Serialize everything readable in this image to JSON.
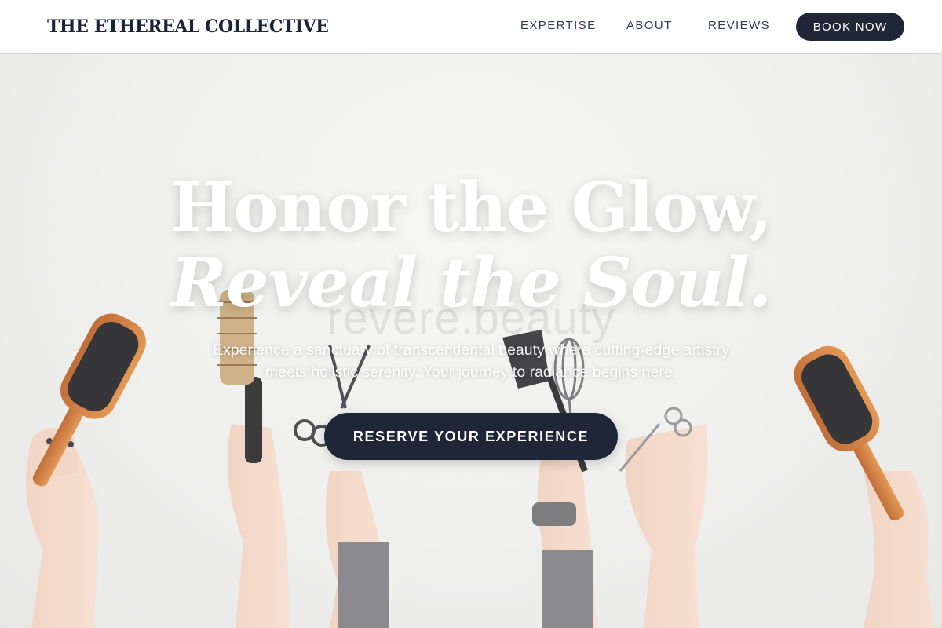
{
  "brand": {
    "name": "THE ETHEREAL COLLECTIVE"
  },
  "nav": {
    "items": [
      {
        "label": "EXPERTISE"
      },
      {
        "label": "ABOUT"
      },
      {
        "label": "REVIEWS"
      }
    ],
    "cta_label": "BOOK NOW"
  },
  "hero": {
    "headline_line1": "Honor the Glow,",
    "headline_line2": "Reveal the Soul.",
    "watermark": "revere.beauty",
    "subtitle": "Experience a sanctuary of transcendental beauty where cutting-edge artistry meets holistic serenity. Your journey to radiance begins here.",
    "cta_label": "RESERVE YOUR EXPERIENCE"
  },
  "colors": {
    "primary": "#1e2638",
    "header_bg": "#ffffff",
    "hero_text": "#ffffff",
    "backdrop": "#efefed"
  },
  "scene": {
    "description_icons": [
      "paddle-brush-icon",
      "round-brush-icon",
      "scissors-icon",
      "tint-brush-icon",
      "whisk-icon",
      "thinning-shears-icon",
      "paddle-brush-icon"
    ]
  }
}
